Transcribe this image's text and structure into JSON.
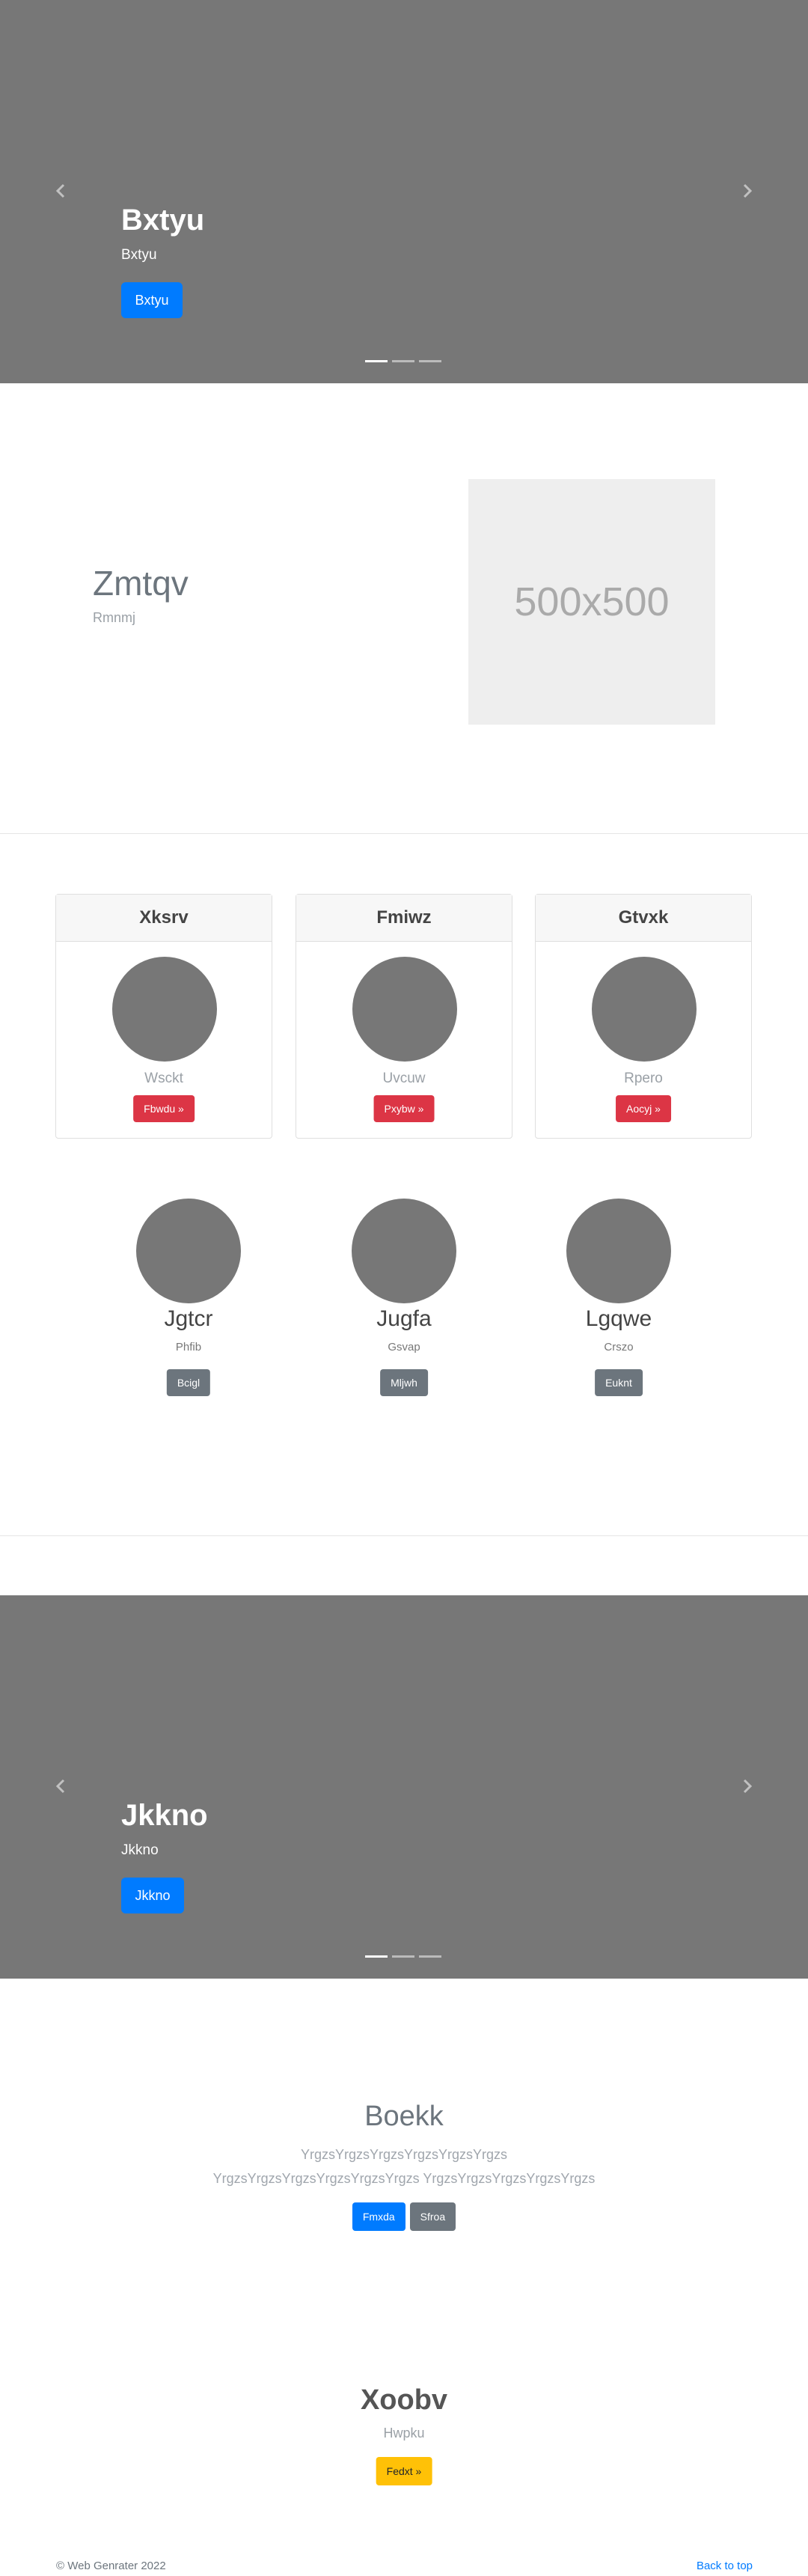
{
  "carousel_top": {
    "title": "Bxtyu",
    "subtitle": "Bxtyu",
    "button": "Bxtyu"
  },
  "featurette": {
    "heading": "Zmtqv",
    "subheading": "Rmnmj",
    "image_placeholder": "500x500"
  },
  "cards": [
    {
      "header": "Xksrv",
      "text": "Wsckt",
      "button": "Fbwdu »"
    },
    {
      "header": "Fmiwz",
      "text": "Uvcuw",
      "button": "Pxybw »"
    },
    {
      "header": "Gtvxk",
      "text": "Rpero",
      "button": "Aocyj »"
    }
  ],
  "profiles": [
    {
      "name": "Jgtcr",
      "role": "Phfib",
      "button": "Bcigl"
    },
    {
      "name": "Jugfa",
      "role": "Gsvap",
      "button": "Mljwh"
    },
    {
      "name": "Lgqwe",
      "role": "Crszo",
      "button": "Euknt"
    }
  ],
  "carousel_bottom": {
    "title": "Jkkno",
    "subtitle": "Jkkno",
    "button": "Jkkno"
  },
  "jumbotron": {
    "title": "Boekk",
    "text": "YrgzsYrgzsYrgzsYrgzsYrgzsYrgzs YrgzsYrgzsYrgzsYrgzsYrgzsYrgzs YrgzsYrgzsYrgzsYrgzsYrgzs",
    "primary_button": "Fmxda",
    "secondary_button": "Sfroa"
  },
  "cta": {
    "title": "Xoobv",
    "subtitle": "Hwpku",
    "button": "Fedxt »"
  },
  "footer": {
    "copyright": "© Web Genrater 2022",
    "back_to_top": "Back to top"
  },
  "icons": {
    "prev": "chevron-left-icon",
    "next": "chevron-right-icon"
  },
  "colors": {
    "primary": "#007bff",
    "danger": "#dc3545",
    "secondary": "#6c757d",
    "warning": "#ffc107",
    "carousel_bg": "#777777"
  }
}
